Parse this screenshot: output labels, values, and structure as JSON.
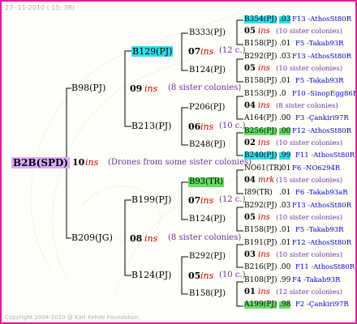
{
  "date": "27- 11-2010 ( 15: 38)",
  "copyright": "Copyright 2004-2010 @ Karl Kehde Foundation.",
  "root": {
    "name": "B2B(SPD)",
    "num": "10",
    "ins": "ins",
    "note": "(Drones from some sister colonies)"
  },
  "g1": [
    {
      "name": "B98(PJ)",
      "num": "09",
      "ins": "ins",
      "note": "(8 sister colonies)"
    },
    {
      "name": "B209(JG)",
      "num": "08",
      "ins": "ins",
      "note": "(8 sister colonies)"
    }
  ],
  "g2": [
    {
      "name": "B129(PJ)",
      "num": "07",
      "ins": "ins",
      "note": "(12 c.)"
    },
    {
      "name": "B213(PJ)",
      "num": "06",
      "ins": "ins",
      "note": "(10 c.)"
    },
    {
      "name": "B199(PJ)",
      "num": "07",
      "ins": "ins",
      "note": "(12 c.)"
    },
    {
      "name": "B124(PJ)",
      "num": "05",
      "ins": "ins",
      "note": "(10 c.)"
    }
  ],
  "g3": [
    "B333(PJ)",
    "B124(PJ)",
    "P206(PJ)",
    "B248(PJ)",
    "B93(TR)",
    "B124(PJ)",
    "B292(PJ)",
    "B158(PJ)"
  ],
  "g4": [
    {
      "top": {
        "name": "B354(PJ)",
        "val": ".03",
        "src": "F13 -AthosSt80R"
      },
      "num": "05",
      "ins": "ins",
      "note": "(10 sister colonies)",
      "bot": {
        "name": "B158(PJ)",
        "val": ".01",
        "src": "F5 -Takab93R"
      }
    },
    {
      "top": {
        "name": "B292(PJ)",
        "val": ".03",
        "src": "F13 -AthosSt80R"
      },
      "num": "05",
      "ins": "ins",
      "note": "(10 sister colonies)",
      "bot": {
        "name": "B158(PJ)",
        "val": ".01",
        "src": "F5 -Takab93R"
      }
    },
    {
      "top": {
        "name": "B153(PJ)",
        "val": ".0",
        "src": "F10 -SinopEgg86R"
      },
      "num": "04",
      "ins": "ins",
      "note": "(8 sister colonies)",
      "bot": {
        "name": "A164(PJ)",
        "val": ".00",
        "src": "F3 -Çankiri97R"
      }
    },
    {
      "top": {
        "name": "B256(PJ)",
        "val": ".00",
        "src": "F12 -AthosSt80R"
      },
      "num": "02",
      "ins": "ins",
      "note": "(10 sister colonies)",
      "bot": {
        "name": "B240(PJ)",
        "val": ".99",
        "src": "F11 -AthosSt80R"
      }
    },
    {
      "top": {
        "name": "NO61(TR)",
        "val": ".01",
        "src": "F6 -NO6294R"
      },
      "num": "04",
      "ins": "mrk",
      "note": "(15 sister colonies)",
      "bot": {
        "name": "I89(TR)",
        "val": ".01",
        "src": "F6 -Takab93aR"
      }
    },
    {
      "top": {
        "name": "B292(PJ)",
        "val": ".03",
        "src": "F13 -AthosSt80R"
      },
      "num": "05",
      "ins": "ins",
      "note": "(10 sister colonies)",
      "bot": {
        "name": "B158(PJ)",
        "val": ".01",
        "src": "F5 -Takab93R"
      }
    },
    {
      "top": {
        "name": "B191(PJ)",
        "val": ".01",
        "src": "F12 -AthosSt80R"
      },
      "num": "03",
      "ins": "ins",
      "note": "(10 sister colonies)",
      "bot": {
        "name": "B216(PJ)",
        "val": ".00",
        "src": "F11 -AthosSt80R"
      }
    },
    {
      "top": {
        "name": "B108(PJ)",
        "val": ".99",
        "src": "F4 -Takab93R"
      },
      "num": "01",
      "ins": "ins",
      "note": "(12 sister colonies)",
      "bot": {
        "name": "A199(PJ)",
        "val": ".98",
        "src": "F2 -Çankiri97R"
      }
    }
  ]
}
